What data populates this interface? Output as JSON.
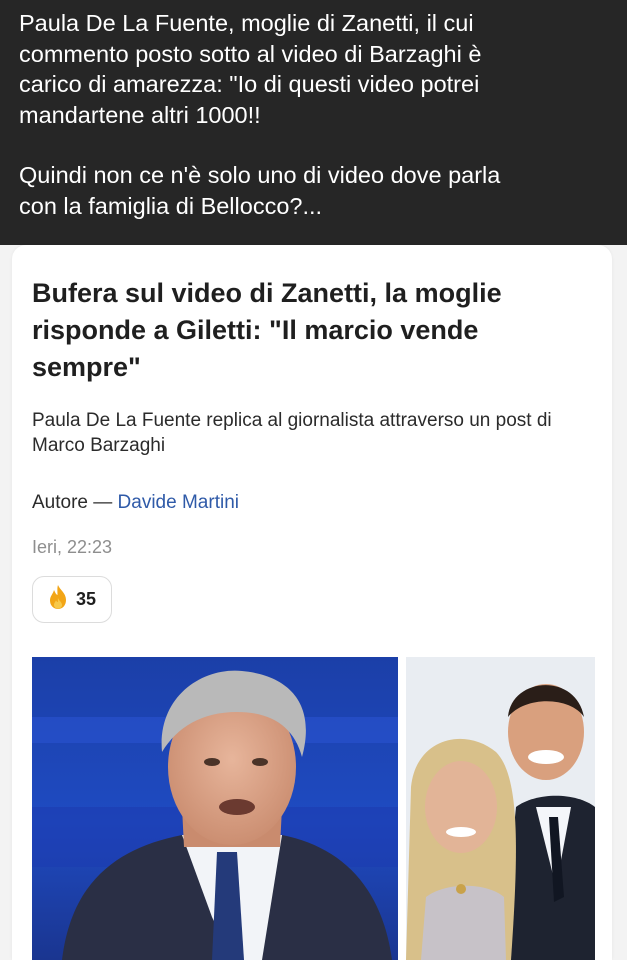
{
  "post": {
    "line1": "Paula De La Fuente, moglie di Zanetti, il cui",
    "line2": "commento posto sotto al video di Barzaghi è",
    "line3": "carico di amarezza: \"Io di questi video potrei",
    "line4": "mandartene altri 1000!!",
    "line5": "Quindi non ce n'è solo uno di video dove parla",
    "line6": "con la famiglia di Bellocco?..."
  },
  "article": {
    "headline": "Bufera sul video di Zanetti, la moglie risponde a Giletti: \"Il marcio vende sempre\"",
    "subtitle": "Paula De La Fuente replica al giornalista attraverso un post di Marco Barzaghi",
    "author_label": "Autore —",
    "author_name": "Davide Martini",
    "date": "Ieri, 22:23",
    "reaction_count": "35",
    "reaction_icon": "fire-icon"
  },
  "colors": {
    "post_bg": "#262626",
    "author_link": "#2f5aa8",
    "fire": "#f2a516"
  }
}
